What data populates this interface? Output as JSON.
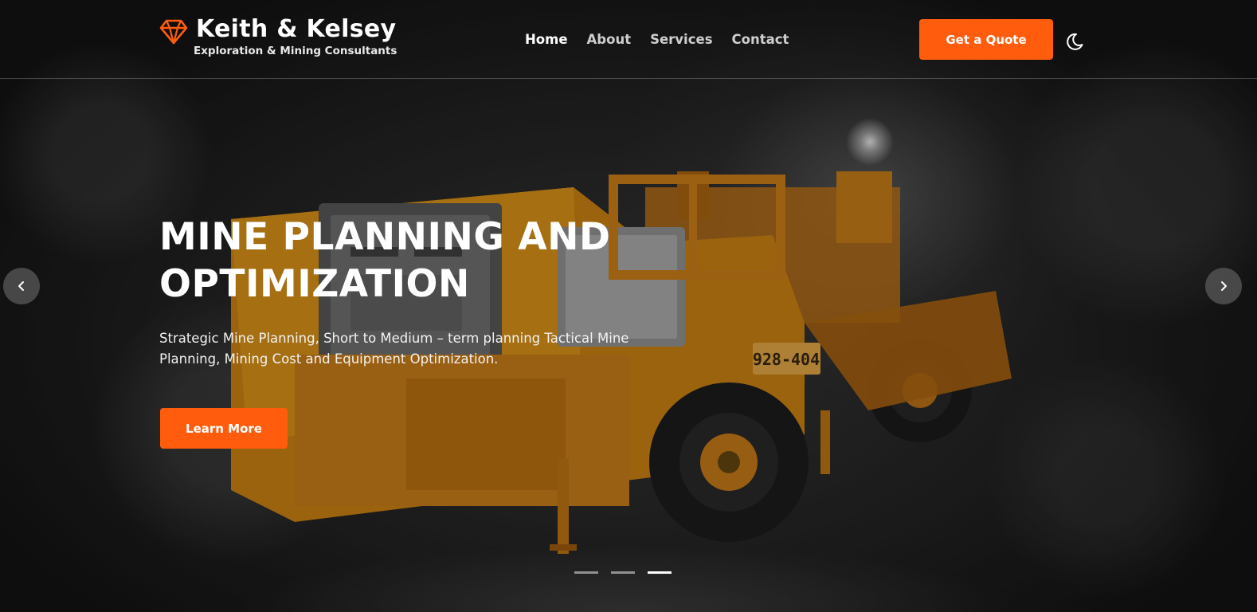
{
  "brand": {
    "title": "Keith & Kelsey",
    "subtitle": "Exploration & Mining Consultants",
    "icon": "diamond-icon",
    "accent_color": "#ff5c0d"
  },
  "nav": {
    "items": [
      {
        "label": "Home",
        "active": true
      },
      {
        "label": "About",
        "active": false
      },
      {
        "label": "Services",
        "active": false
      },
      {
        "label": "Contact",
        "active": false
      }
    ],
    "cta_label": "Get a Quote",
    "theme_toggle_icon": "moon-icon"
  },
  "slide": {
    "title_line1": "MINE PLANNING AND",
    "title_line2": "OPTIMIZATION",
    "description": "Strategic Mine Planning, Short to Medium – term planning Tactical Mine Planning, Mining Cost and Equipment Optimization.",
    "button_label": "Learn More",
    "machine_plate": "928-404"
  },
  "carousel": {
    "prev_icon": "chevron-left-icon",
    "next_icon": "chevron-right-icon",
    "slide_count": 3,
    "active_index": 2
  }
}
